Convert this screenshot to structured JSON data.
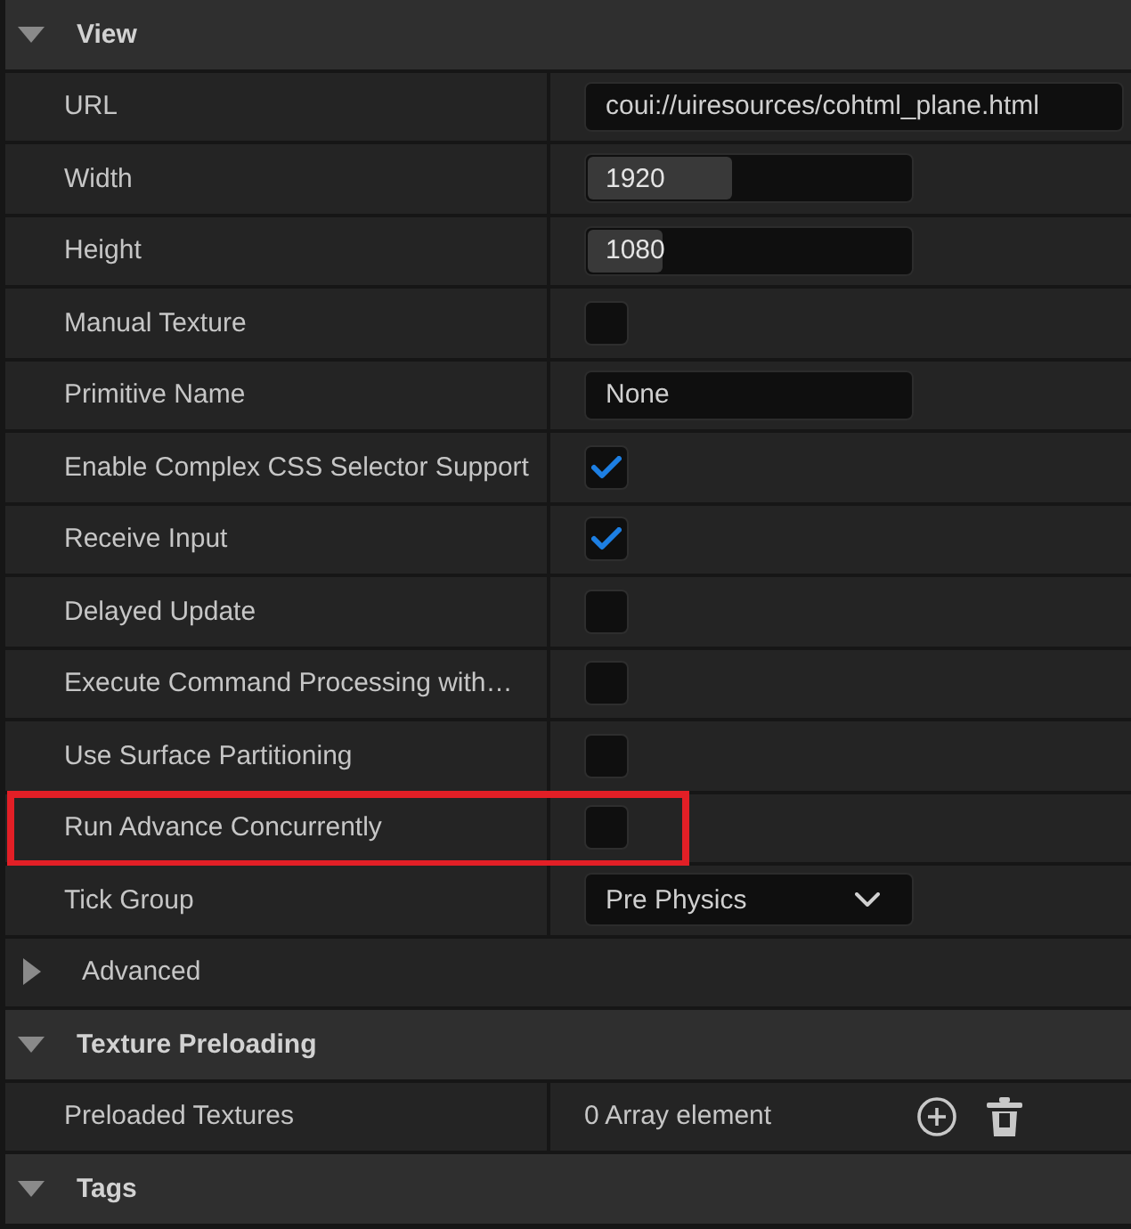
{
  "sections": [
    {
      "title": "View",
      "expanded": true,
      "properties": [
        {
          "kind": "url",
          "label": "URL",
          "value": "coui://uiresources/cohtml_plane.html",
          "highlighted": false
        },
        {
          "kind": "number",
          "label": "Width",
          "value": "1920",
          "level": 0.44,
          "highlighted": false
        },
        {
          "kind": "number",
          "label": "Height",
          "value": "1080",
          "level": 0.23,
          "highlighted": false
        },
        {
          "kind": "checkbox",
          "label": "Manual Texture",
          "checked": false,
          "highlighted": false
        },
        {
          "kind": "text",
          "label": "Primitive Name",
          "value": "None",
          "highlighted": false
        },
        {
          "kind": "checkbox",
          "label": "Enable Complex CSS Selector Support",
          "checked": true,
          "highlighted": false
        },
        {
          "kind": "checkbox",
          "label": "Receive Input",
          "checked": true,
          "highlighted": false
        },
        {
          "kind": "checkbox",
          "label": "Delayed Update",
          "checked": false,
          "highlighted": false
        },
        {
          "kind": "checkbox",
          "label": "Execute Command Processing with…",
          "checked": false,
          "highlighted": false
        },
        {
          "kind": "checkbox",
          "label": "Use Surface Partitioning",
          "checked": false,
          "highlighted": false
        },
        {
          "kind": "checkbox",
          "label": "Run Advance Concurrently",
          "checked": false,
          "highlighted": true
        },
        {
          "kind": "combo",
          "label": "Tick Group",
          "value": "Pre Physics",
          "highlighted": false
        },
        {
          "kind": "group",
          "label": "Advanced",
          "expanded": false,
          "highlighted": false
        }
      ]
    },
    {
      "title": "Texture Preloading",
      "expanded": true,
      "properties": [
        {
          "kind": "array",
          "label": "Preloaded Textures",
          "value": "0 Array element",
          "highlighted": false
        }
      ]
    },
    {
      "title": "Tags",
      "expanded": true
    }
  ]
}
